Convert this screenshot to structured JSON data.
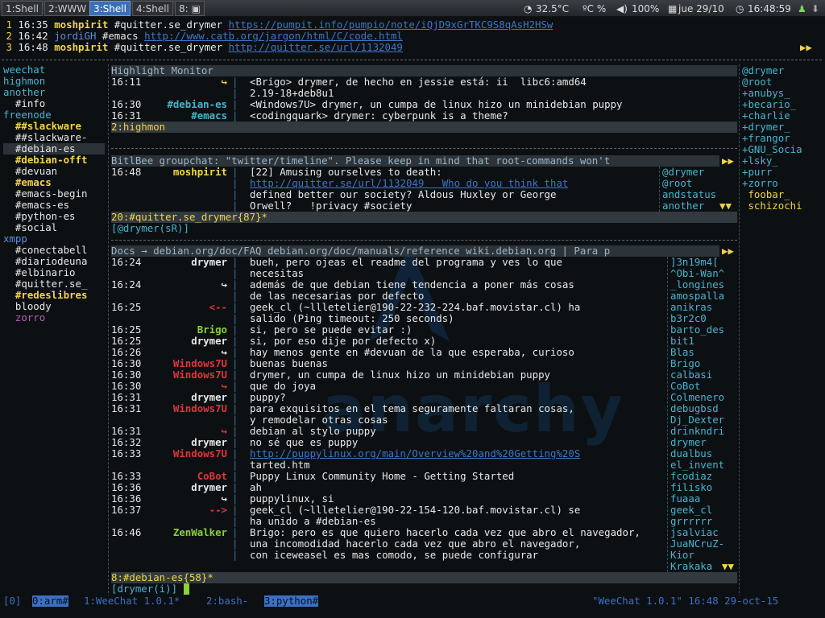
{
  "topbar": {
    "workspaces": [
      "1:Shell",
      "2:WWW",
      "3:Shell",
      "4:Shell",
      "8:"
    ],
    "active_workspace": "3:Shell",
    "cpu_temp": "32.5°C",
    "temp_unit": "ºC %",
    "volume": "100%",
    "date": "jue 29/10",
    "time": "16:48:59"
  },
  "highlight_lines": [
    {
      "n": "1",
      "t": "16:35",
      "nick": "moshpirit",
      "text": "#quitter.se_drymer",
      "url": "https://pumpit.info/pumpio/note/iQjD9xGrTKC9S8qAsH2HSw"
    },
    {
      "n": "2",
      "t": "16:42",
      "nick": "jordiGH",
      "text": "#emacs",
      "url": "http://www.catb.org/jargon/html/C/code.html"
    },
    {
      "n": "3",
      "t": "16:48",
      "nick": "moshpirit",
      "text": "#quitter.se_drymer",
      "url": "http://quitter.se/url/1132049"
    }
  ],
  "buffers": [
    {
      "label": "weechat",
      "cls": "cyan"
    },
    {
      "label": "highmon",
      "cls": "cyan"
    },
    {
      "label": "another",
      "cls": "cyan"
    },
    {
      "label": "  #info",
      "cls": "white"
    },
    {
      "label": "freenode",
      "cls": "cyan"
    },
    {
      "label": "  ##slackware",
      "cls": "yellow bold"
    },
    {
      "label": "  ##slackware-",
      "cls": "white"
    },
    {
      "label": "  #debian-es",
      "cls": "white",
      "active": true
    },
    {
      "label": "  #debian-offt",
      "cls": "yellow bold"
    },
    {
      "label": "  #devuan",
      "cls": "white"
    },
    {
      "label": "  #emacs",
      "cls": "yellow bold"
    },
    {
      "label": "  #emacs-begin",
      "cls": "white"
    },
    {
      "label": "  #emacs-es",
      "cls": "white"
    },
    {
      "label": "  #python-es",
      "cls": "white"
    },
    {
      "label": "  #social",
      "cls": "white"
    },
    {
      "label": "xmpp",
      "cls": "blue"
    },
    {
      "label": "  #conectabell",
      "cls": "white"
    },
    {
      "label": "  #diariodeuna",
      "cls": "white"
    },
    {
      "label": "  #elbinario",
      "cls": "white"
    },
    {
      "label": "  #quitter.se_",
      "cls": "white"
    },
    {
      "label": "  #redeslibres",
      "cls": "yellow bold"
    },
    {
      "label": "  bloody",
      "cls": "white"
    },
    {
      "label": "  zorro",
      "cls": "magenta"
    }
  ],
  "highmon": {
    "title": "Highlight Monitor",
    "lines": [
      {
        "t": "16:11",
        "nick": "↪",
        "nc": "yellow",
        "msg": "<Brigo> drymer, de hecho en jessie está: ii  libc6:amd64"
      },
      {
        "t": "",
        "nick": "",
        "nc": "",
        "msg": "2.19-18+deb8u1"
      },
      {
        "t": "16:30",
        "nick": "#debian-es",
        "nc": "cyan",
        "msg": "<Windows7U> drymer, un cumpa de linux hizo un minidebian puppy"
      },
      {
        "t": "16:31",
        "nick": "#emacs",
        "nc": "cyan",
        "msg": "<codingquark> drymer: cyberpunk is a theme?"
      }
    ],
    "status": "2:highmon"
  },
  "bitlbee": {
    "title": "BitlBee groupchat: \"twitter/timeline\". Please keep in mind that root-commands won't",
    "lines": [
      {
        "t": "16:48",
        "nick": "moshpirit",
        "msg": "[22] Amusing ourselves to death:"
      },
      {
        "t": "",
        "nick": "",
        "msg": "http://quitter.se/url/1132049   Who do you think that"
      },
      {
        "t": "",
        "nick": "",
        "msg": "defined better our society? Aldous Huxley or George"
      },
      {
        "t": "",
        "nick": "",
        "msg": "Orwell?   !privacy #society"
      }
    ],
    "nicks": [
      "@drymer",
      "@root",
      "andstatus",
      "another"
    ],
    "status": "20:#quitter.se_drymer{87}*",
    "input": "[@drymer(sR)]"
  },
  "debian": {
    "title": "Docs → debian.org/doc/FAQ debian.org/doc/manuals/reference wiki.debian.org | Para p",
    "lines": [
      {
        "t": "16:24",
        "nick": "drymer",
        "nc": "white",
        "msg": "bueh, pero ojeas el readme del programa y ves lo que"
      },
      {
        "t": "",
        "nick": "",
        "nc": "",
        "msg": "necesitas"
      },
      {
        "t": "16:24",
        "nick": "↪",
        "nc": "white",
        "msg": "además de que debian tiene tendencia a poner más cosas"
      },
      {
        "t": "",
        "nick": "",
        "nc": "",
        "msg": "de las necesarias por defecto"
      },
      {
        "t": "16:25",
        "nick": "<--",
        "nc": "red",
        "msg": "geek_cl (~llletelier@190-22-232-224.baf.movistar.cl) ha"
      },
      {
        "t": "",
        "nick": "",
        "nc": "",
        "msg": "salido (Ping timeout: 250 seconds)"
      },
      {
        "t": "16:25",
        "nick": "Brigo",
        "nc": "green",
        "msg": "si, pero se puede evitar :)"
      },
      {
        "t": "16:25",
        "nick": "drymer",
        "nc": "white",
        "msg": "si, por eso dije por defecto x)"
      },
      {
        "t": "16:26",
        "nick": "↪",
        "nc": "white",
        "msg": "hay menos gente en #devuan de la que esperaba, curioso"
      },
      {
        "t": "16:30",
        "nick": "Windows7U",
        "nc": "red",
        "msg": "buenas buenas"
      },
      {
        "t": "16:30",
        "nick": "Windows7U",
        "nc": "red",
        "msg": "drymer, un cumpa de linux hizo un minidebian puppy"
      },
      {
        "t": "16:30",
        "nick": "↪",
        "nc": "red",
        "msg": "que do joya"
      },
      {
        "t": "16:31",
        "nick": "drymer",
        "nc": "white",
        "msg": "puppy?"
      },
      {
        "t": "16:31",
        "nick": "Windows7U",
        "nc": "red",
        "msg": "para exquisitos en el tema seguramente faltaran cosas,"
      },
      {
        "t": "",
        "nick": "",
        "nc": "",
        "msg": "y remodelar otras cosas"
      },
      {
        "t": "16:31",
        "nick": "↪",
        "nc": "red",
        "msg": "debian al stylo puppy"
      },
      {
        "t": "16:32",
        "nick": "drymer",
        "nc": "white",
        "msg": "no sé que es puppy"
      },
      {
        "t": "16:33",
        "nick": "Windows7U",
        "nc": "red",
        "msg": "http://puppylinux.org/main/Overview%20and%20Getting%20S"
      },
      {
        "t": "",
        "nick": "",
        "nc": "",
        "msg": "tarted.htm"
      },
      {
        "t": "16:33",
        "nick": "CoBot",
        "nc": "red",
        "msg": "Puppy Linux Community Home - Getting Started"
      },
      {
        "t": "16:36",
        "nick": "drymer",
        "nc": "white",
        "msg": "ah"
      },
      {
        "t": "16:36",
        "nick": "↪",
        "nc": "white",
        "msg": "puppylinux, si"
      },
      {
        "t": "16:37",
        "nick": "-->",
        "nc": "red",
        "msg": "geek_cl (~llletelier@190-22-154-120.baf.movistar.cl) se"
      },
      {
        "t": "",
        "nick": "",
        "nc": "",
        "msg": "ha unido a #debian-es"
      },
      {
        "t": "16:46",
        "nick": "ZenWalker",
        "nc": "green",
        "msg": "Brigo: pero es que quiero hacerlo cada vez que abro el navegador,"
      },
      {
        "t": "",
        "nick": "",
        "nc": "",
        "msg": "una incomodidad hacerlo cada vez que abro el navegador,"
      },
      {
        "t": "",
        "nick": "",
        "nc": "",
        "msg": "con iceweasel es mas comodo, se puede configurar"
      }
    ],
    "nicks": [
      "]3n19m4[",
      "^Obi-Wan^",
      "_longines",
      "amospalla",
      "anikras",
      "b3r2c0",
      "barto_des",
      "bit1",
      "Blas",
      "Brigo",
      "calbasi",
      "CoBot",
      "Colmenero",
      "debugbsd",
      "Dj_Dexter",
      "drinkndri",
      "drymer",
      "dualbus",
      "el_invent",
      "fcodiaz",
      "filisko",
      "fuaaa",
      "geek_cl",
      "grrrrrr",
      "jsalviac",
      "JuaNCruZ-",
      "Kior",
      "Krakaka"
    ],
    "status": "8:#debian-es{58}*",
    "input": "[drymer(i)] "
  },
  "right_nicks": [
    "@drymer",
    "@root",
    "+anubys_",
    "+becario_",
    "+charlie",
    "+drymer_",
    "+frangor",
    "+GNU_Socia",
    "+lsky_",
    "+purr",
    "+zorro",
    " foobar_",
    " schizochi"
  ],
  "tmux": {
    "left": "[0] 0:arm# 1:WeeChat 1.0.1* 2:bash- 3:python#",
    "items": [
      "[0]",
      "0:arm#",
      "1:WeeChat 1.0.1*",
      "2:bash-",
      "3:python#"
    ],
    "right": "\"WeeChat 1.0.1\" 16:48 29-oct-15"
  },
  "colors": {
    "accent": "#3c6eb4",
    "separator": "#3f6e95",
    "nick_yellow": "#f2d448"
  }
}
